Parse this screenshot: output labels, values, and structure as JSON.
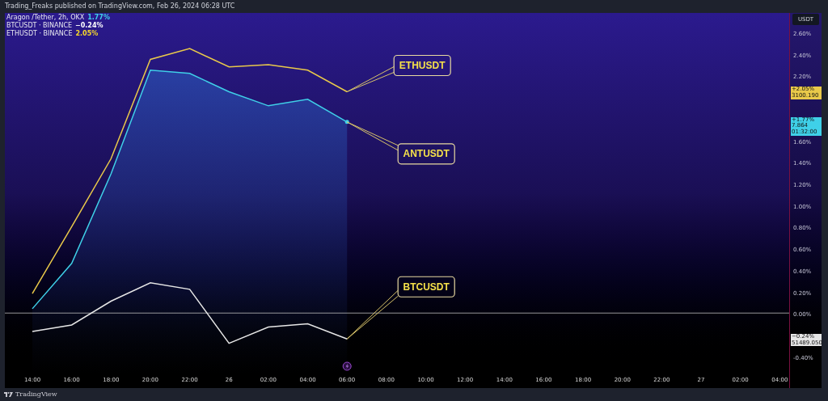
{
  "header": {
    "text": "Trading_Freaks published on TradingView.com, Feb 26, 2024 06:28 UTC"
  },
  "legend": [
    {
      "name": "Aragon /Tether, 2h, OKX",
      "value": "1.77%",
      "color": "#3fd0e8"
    },
    {
      "name": "BTCUSDT · BINANCE",
      "value": "−0.24%",
      "color": "#ffffff"
    },
    {
      "name": "ETHUSDT · BINANCE",
      "value": "2.05%",
      "color": "#f7d92a"
    }
  ],
  "currency_button": "USDT",
  "chart": {
    "chart_data": {
      "type": "line",
      "categories": [
        "14:00",
        "16:00",
        "18:00",
        "20:00",
        "22:00",
        "26",
        "02:00",
        "04:00",
        "06:00",
        "08:00",
        "10:00",
        "12:00",
        "14:00",
        "16:00",
        "18:00",
        "20:00",
        "22:00",
        "27",
        "02:00",
        "04:00"
      ],
      "series": [
        {
          "name": "ETHUSDT",
          "color": "#e9c94a",
          "values": [
            0.18,
            0.8,
            1.43,
            2.35,
            2.45,
            2.28,
            2.3,
            2.25,
            2.05,
            null,
            null,
            null,
            null,
            null,
            null,
            null,
            null,
            null,
            null,
            null
          ]
        },
        {
          "name": "ANTUSDT",
          "color": "#3fd0e8",
          "values": [
            0.04,
            0.46,
            1.29,
            2.25,
            2.22,
            2.05,
            1.92,
            1.98,
            1.77,
            null,
            null,
            null,
            null,
            null,
            null,
            null,
            null,
            null,
            null,
            null
          ]
        },
        {
          "name": "BTCUSDT",
          "color": "#e6e6e6",
          "values": [
            -0.17,
            -0.11,
            0.11,
            0.28,
            0.22,
            -0.28,
            -0.13,
            -0.1,
            -0.24,
            null,
            null,
            null,
            null,
            null,
            null,
            null,
            null,
            null,
            null,
            null
          ]
        }
      ],
      "ylim": [
        -0.56,
        2.78
      ],
      "yticks": [
        {
          "value": 2.6,
          "label": "2.60%"
        },
        {
          "value": 2.4,
          "label": "2.40%"
        },
        {
          "value": 2.2,
          "label": "2.20%"
        },
        {
          "value": 1.6,
          "label": "1.60%"
        },
        {
          "value": 1.4,
          "label": "1.40%"
        },
        {
          "value": 1.2,
          "label": "1.20%"
        },
        {
          "value": 1.0,
          "label": "1.00%"
        },
        {
          "value": 0.8,
          "label": "0.80%"
        },
        {
          "value": 0.6,
          "label": "0.60%"
        },
        {
          "value": 0.4,
          "label": "0.40%"
        },
        {
          "value": 0.2,
          "label": "0.20%"
        },
        {
          "value": 0,
          "label": "0.00%"
        },
        {
          "value": -0.4,
          "label": "-0.40%"
        }
      ]
    }
  },
  "price_badges": [
    {
      "lines": [
        "+2.05%",
        "3100.190"
      ]
    },
    {
      "lines": [
        "+1.77%",
        "7.864",
        "01:32:00"
      ]
    },
    {
      "lines": [
        "−0.24%",
        "51489.050"
      ]
    }
  ],
  "footer": {
    "brand": "TradingView"
  }
}
